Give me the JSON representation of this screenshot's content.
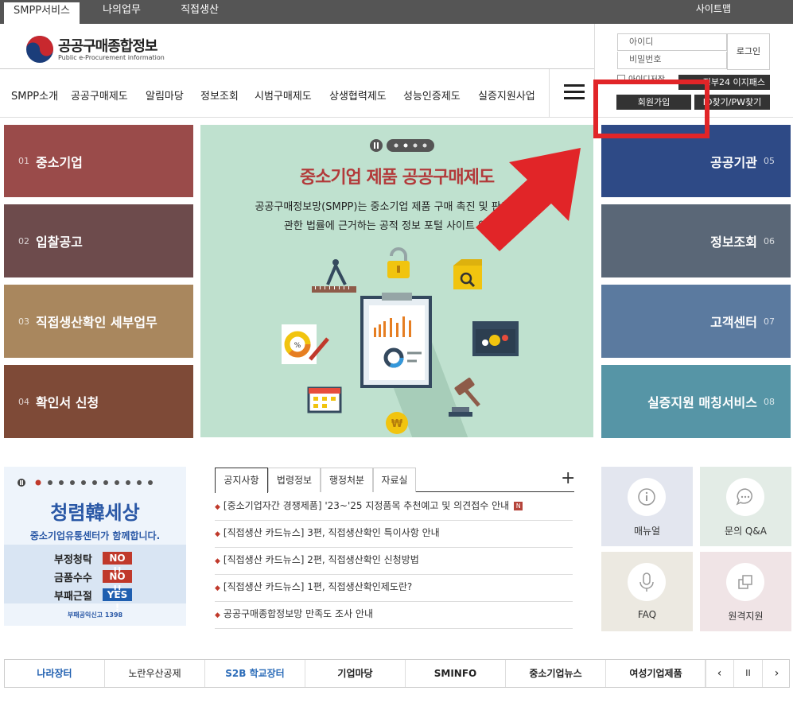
{
  "top_tabs": [
    {
      "label": "SMPP서비스"
    },
    {
      "label": "나의업무"
    },
    {
      "label": "직접생산"
    }
  ],
  "sitemap": "사이트맵",
  "logo": {
    "title": "공공구매종합정보",
    "subtitle": "Public e-Procurement information"
  },
  "gnb": [
    "SMPP소개",
    "공공구매제도",
    "알림마당",
    "정보조회",
    "시범구매제도",
    "상생협력제도",
    "성능인증제도",
    "실증지원사업"
  ],
  "login": {
    "id_placeholder": "아이디",
    "pw_placeholder": "비밀번호",
    "login_button": "로그인",
    "save_id": "아이디저장",
    "easy_login": "정부24 이지패스",
    "join_button": "회원가입",
    "find_button": "ID찾기/PW찾기"
  },
  "left_tiles": [
    {
      "num": "01",
      "label": "중소기업",
      "color": "#9a4b4a"
    },
    {
      "num": "02",
      "label": "입찰공고",
      "color": "#6d4b4c"
    },
    {
      "num": "03",
      "label": "직접생산확인 세부업무",
      "color": "#a9875e"
    },
    {
      "num": "04",
      "label": "확인서 신청",
      "color": "#7e4a37"
    }
  ],
  "right_tiles": [
    {
      "num": "05",
      "label": "공공기관",
      "color": "#2e4a86"
    },
    {
      "num": "06",
      "label": "정보조회",
      "color": "#5a6777"
    },
    {
      "num": "07",
      "label": "고객센터",
      "color": "#5b7a9f"
    },
    {
      "num": "08",
      "label": "실증지원 매칭서비스",
      "color": "#5695a6"
    }
  ],
  "banner": {
    "title": "중소기업 제품 공공구매제도",
    "line1": "공공구매정보망(SMPP)는 중소기업 제품 구매 촉진 및 판로지원에",
    "line2": "관한 법률에 근거하는 공적 정보 포털 사이트 입니다."
  },
  "promo": {
    "title": "청렴韓세상",
    "subtitle": "중소기업유통센터가 함께합니다.",
    "rows": [
      {
        "text": "부정청탁",
        "badge": "NO !!"
      },
      {
        "text": "금품수수",
        "badge": "NO !!"
      },
      {
        "text": "부패근절",
        "badge": "YES !"
      }
    ],
    "footer": "부패공익신고 1398"
  },
  "notice_tabs": [
    "공지사항",
    "법령정보",
    "행정처분",
    "자료실"
  ],
  "more": "+",
  "notices": [
    {
      "text": "[중소기업자간 경쟁제품] '23~'25 지정품목 추천예고 및 의견접수 안내",
      "new": "N"
    },
    {
      "text": "[직접생산 카드뉴스] 3편, 직접생산확인 특이사항 안내"
    },
    {
      "text": "[직접생산 카드뉴스] 2편, 직접생산확인 신청방법"
    },
    {
      "text": "[직접생산 카드뉴스] 1편, 직접생산확인제도란?"
    },
    {
      "text": "공공구매종합정보망 만족도 조사 안내"
    }
  ],
  "quick": [
    {
      "label": "매뉴얼",
      "icon": "info-icon",
      "color": "#e3e6ef"
    },
    {
      "label": "문의 Q&A",
      "icon": "chat-icon",
      "color": "#e3ece6"
    },
    {
      "label": "FAQ",
      "icon": "mic-icon",
      "color": "#ece9e1"
    },
    {
      "label": "원격지원",
      "icon": "copy-icon",
      "color": "#f0e4e6"
    }
  ],
  "related_links": [
    "나라장터",
    "노란우산공제",
    "S2B 학교장터",
    "기업마당",
    "SMINFO",
    "중소기업뉴스",
    "여성기업제품"
  ],
  "controls": {
    "prev": "‹",
    "pause": "II",
    "next": "›"
  }
}
